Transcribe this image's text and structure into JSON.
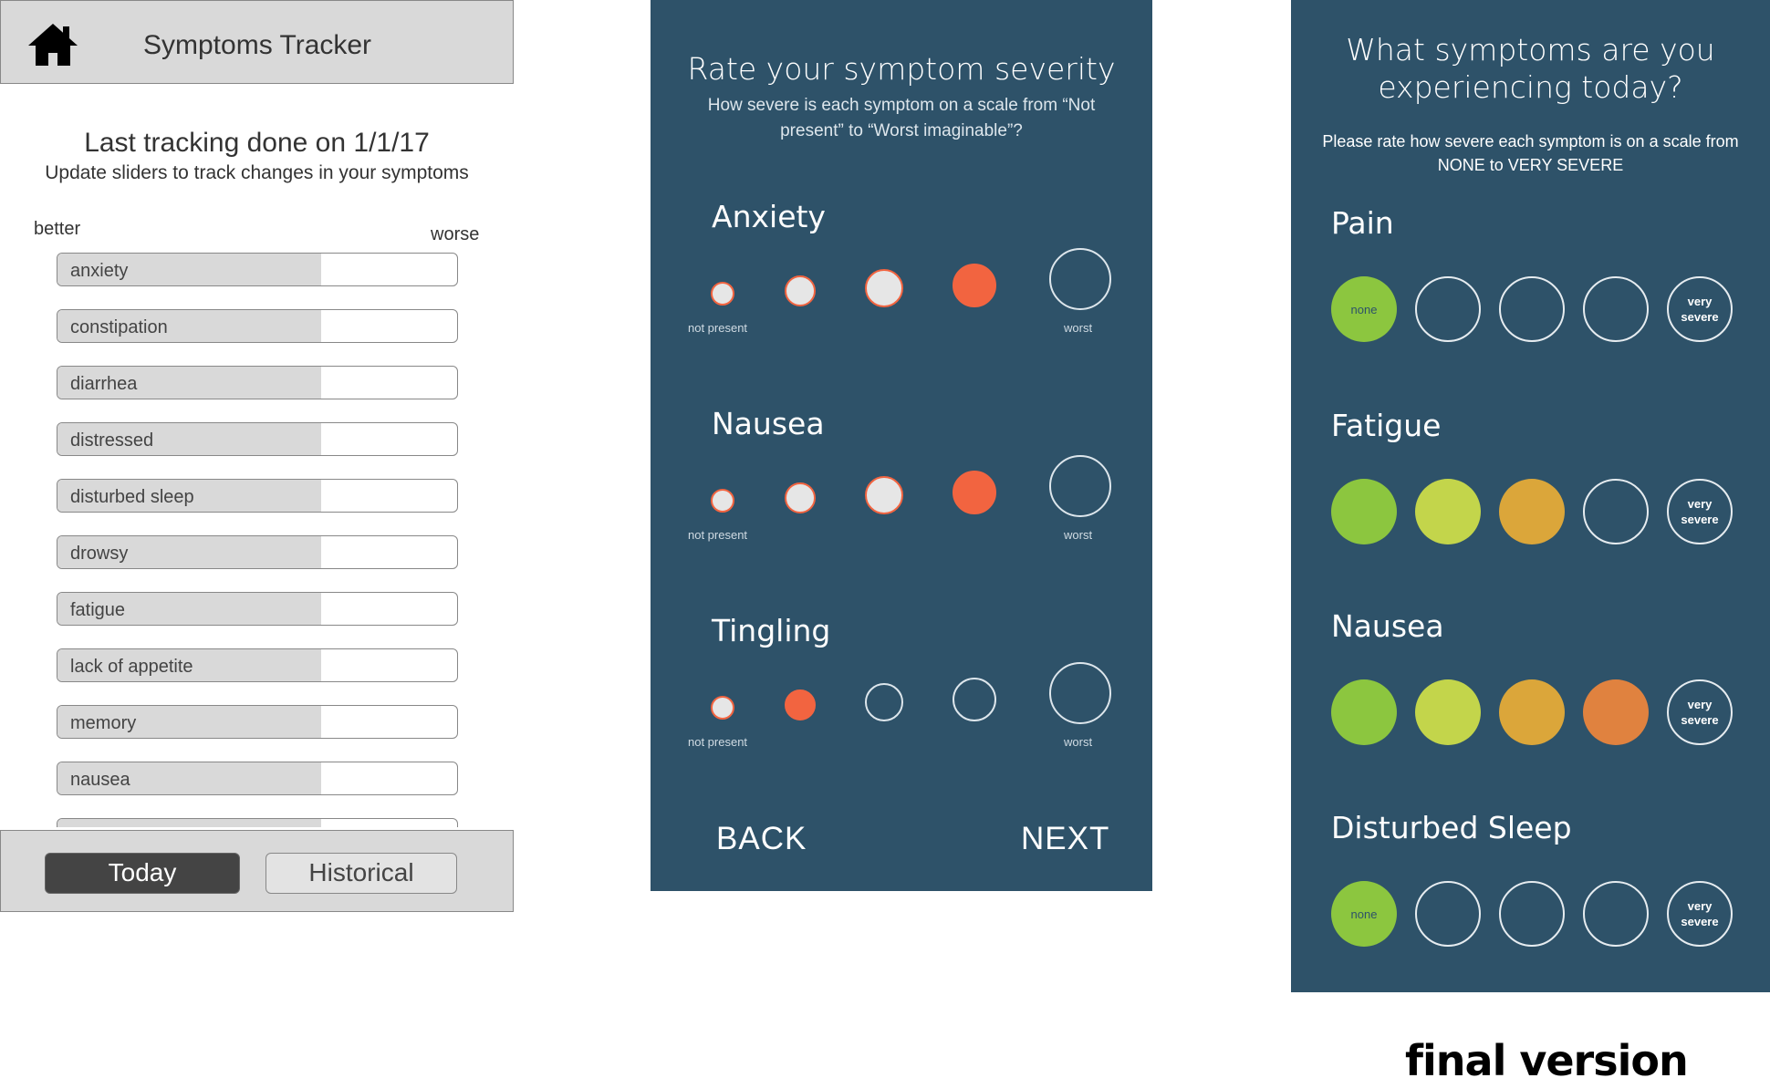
{
  "screen1": {
    "header_title": "Symptoms Tracker",
    "last_tracking": "Last tracking done on 1/1/17",
    "instruction": "Update sliders to track changes in your symptoms",
    "scale_better": "better",
    "scale_worse": "worse",
    "sliders": [
      {
        "label": "anxiety",
        "value": 0.66
      },
      {
        "label": "constipation",
        "value": 0.66
      },
      {
        "label": "diarrhea",
        "value": 0.66
      },
      {
        "label": "distressed",
        "value": 0.66
      },
      {
        "label": "disturbed sleep",
        "value": 0.66
      },
      {
        "label": "drowsy",
        "value": 0.66
      },
      {
        "label": "fatigue",
        "value": 0.66
      },
      {
        "label": "lack of appetite",
        "value": 0.66
      },
      {
        "label": "memory",
        "value": 0.66
      },
      {
        "label": "nausea",
        "value": 0.66
      },
      {
        "label": "",
        "value": 0.66
      }
    ],
    "tab_today": "Today",
    "tab_historical": "Historical"
  },
  "screen2": {
    "title": "Rate your symptom severity",
    "subtitle": "How severe is each symptom on a scale from “Not present” to “Worst imaginable”?",
    "symptoms": [
      {
        "name": "Anxiety",
        "selected_level": 4
      },
      {
        "name": "Nausea",
        "selected_level": 4
      },
      {
        "name": "Tingling",
        "selected_level": 2
      }
    ],
    "caption_low": "not present",
    "caption_high": "worst",
    "back_label": "BACK",
    "next_label": "NEXT",
    "colors": {
      "background": "#2e5269",
      "accent": "#f26440",
      "light": "#e6e6e6"
    }
  },
  "screen3": {
    "title": "What symptoms are you experiencing today?",
    "subtitle": "Please rate how severe each symptom is on a scale from NONE to VERY SEVERE",
    "label_none": "none",
    "label_very_severe": "very severe",
    "symptoms": [
      {
        "name": "Pain",
        "selected_level": 1
      },
      {
        "name": "Fatigue",
        "selected_level": 3
      },
      {
        "name": "Nausea",
        "selected_level": 4
      },
      {
        "name": "Disturbed Sleep",
        "selected_level": 1
      }
    ],
    "level_colors": [
      "#8cc63f",
      "#c3d54b",
      "#dba63a",
      "#e0823f"
    ],
    "background": "#2e5269"
  },
  "caption": "final version"
}
